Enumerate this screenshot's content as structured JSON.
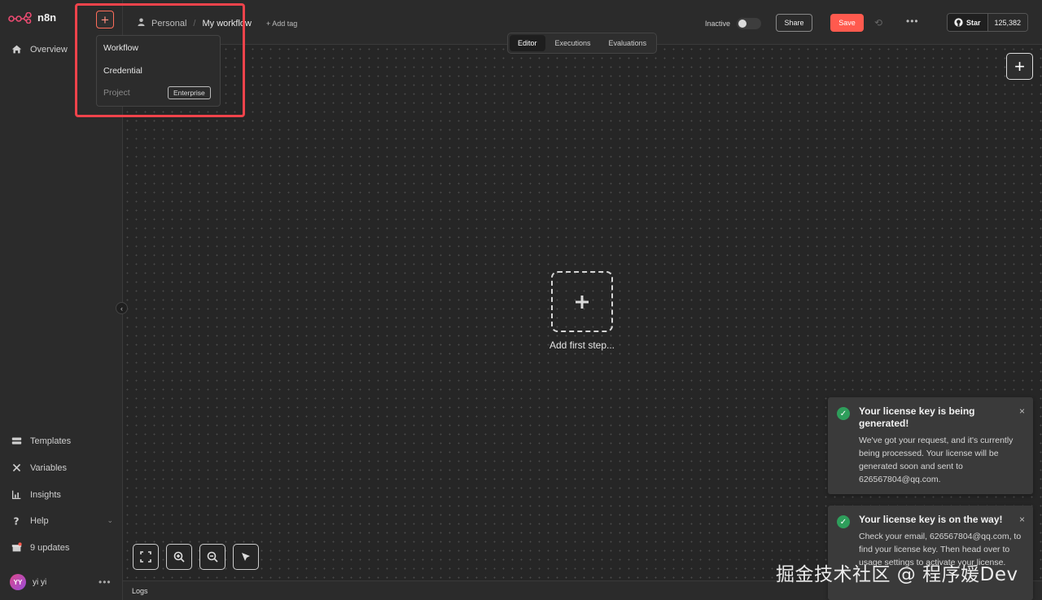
{
  "app": {
    "name": "n8n"
  },
  "sidebar": {
    "overview": "Overview",
    "templates": "Templates",
    "variables": "Variables",
    "insights": "Insights",
    "help": "Help",
    "updates": "9 updates",
    "user_initials": "YY",
    "user_name": "yi yi"
  },
  "create_menu": {
    "items": [
      "Workflow",
      "Credential",
      "Project"
    ],
    "project_badge": "Enterprise"
  },
  "header": {
    "project": "Personal",
    "separator": "/",
    "workflow_name": "My workflow",
    "add_tag": "+ Add tag",
    "status_label": "Inactive",
    "share_label": "Share",
    "save_label": "Save",
    "github_star": "Star",
    "github_count": "125,382"
  },
  "tabs": [
    "Editor",
    "Executions",
    "Evaluations"
  ],
  "active_tab": "Editor",
  "canvas": {
    "first_step_label": "Add first step..."
  },
  "logs_label": "Logs",
  "toasts": [
    {
      "title": "Your license key is being generated!",
      "body": "We've got your request, and it's currently being processed. Your license will be generated soon and sent to 626567804@qq.com."
    },
    {
      "title": "Your license key is on the way!",
      "body": "Check your email, 626567804@qq.com, to find your license key. Then head over to usage settings to activate your license."
    }
  ],
  "watermark": "掘金技术社区 @ 程序媛Dev",
  "colors": {
    "accent": "#ff5a4e",
    "highlight": "#f0434b",
    "success": "#2e9e5b"
  }
}
